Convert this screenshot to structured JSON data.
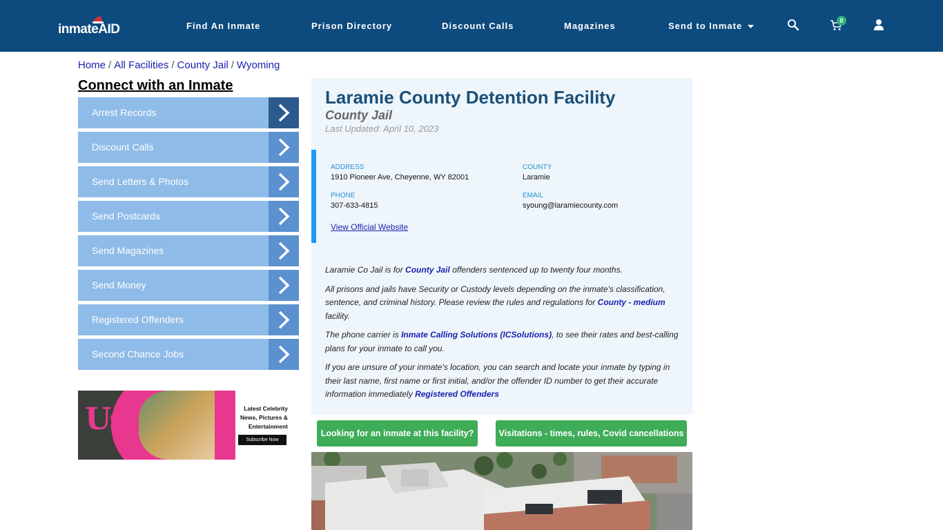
{
  "nav": {
    "logo_text": "inmateAID",
    "items": [
      "Find An Inmate",
      "Prison Directory",
      "Discount Calls",
      "Magazines",
      "Send to Inmate"
    ],
    "cart_count": "0"
  },
  "breadcrumb": [
    "Home",
    "All Facilities",
    "County Jail",
    "Wyoming"
  ],
  "sidebar": {
    "title": "Connect with an Inmate",
    "items": [
      "Arrest Records",
      "Discount Calls",
      "Send Letters & Photos",
      "Send Postcards",
      "Send Magazines",
      "Send Money",
      "Registered Offenders",
      "Second Chance Jobs"
    ]
  },
  "ad": {
    "brand": "Us",
    "line1": "Latest Celebrity",
    "line2": "News, Pictures &",
    "line3": "Entertainment",
    "button": "Subscribe Now"
  },
  "facility": {
    "name": "Laramie County Detention Facility",
    "type": "County Jail",
    "updated": "Last Updated: April 10, 2023",
    "address_label": "ADDRESS",
    "address": "1910 Pioneer Ave, Cheyenne, WY 82001",
    "county_label": "COUNTY",
    "county": "Laramie",
    "phone_label": "PHONE",
    "phone": "307-633-4815",
    "email_label": "EMAIL",
    "email": "syoung@laramiecounty.com",
    "website_link": "View Official Website"
  },
  "description": {
    "p1_a": "Laramie Co Jail is for ",
    "p1_link": "County Jail",
    "p1_b": " offenders sentenced up to twenty four months.",
    "p2_a": "All prisons and jails have Security or Custody levels depending on the inmate's classification, sentence, and criminal history. Please review the rules and regulations for ",
    "p2_link": "County - medium",
    "p2_b": " facility.",
    "p3_a": "The phone carrier is ",
    "p3_link": "Inmate Calling Solutions (ICSolutions)",
    "p3_b": ", to see their rates and best-calling plans for your inmate to call you.",
    "p4_a": "If you are unsure of your inmate's location, you can search and locate your inmate by typing in their last name, first name or first initial, and/or the offender ID number to get their accurate information immediately ",
    "p4_link": "Registered Offenders"
  },
  "buttons": {
    "looking": "Looking for an inmate at this facility?",
    "visitations": "Visitations - times, rules, Covid cancellations"
  }
}
